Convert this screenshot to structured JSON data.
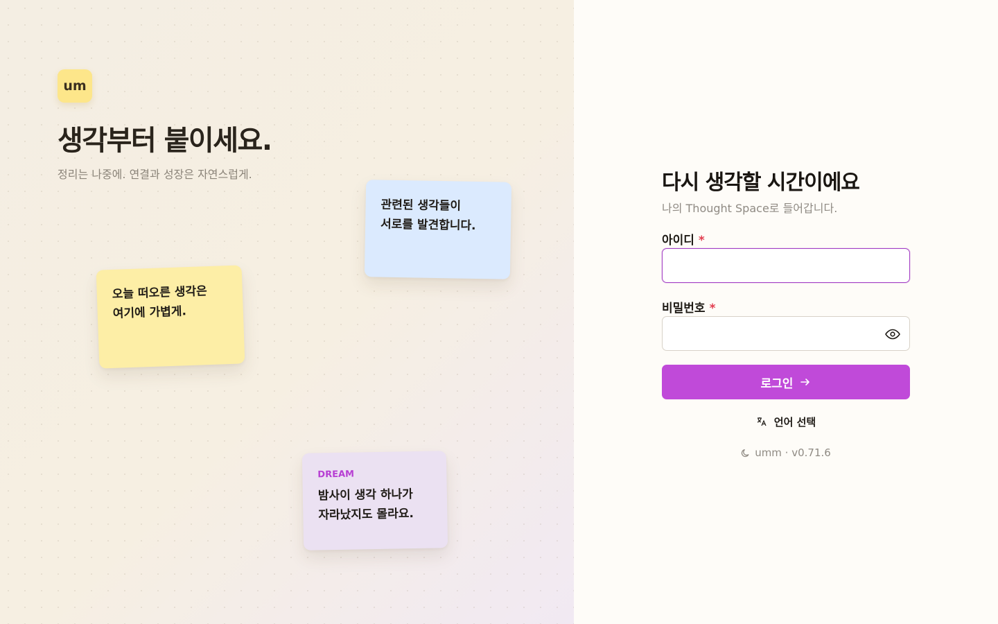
{
  "brand": {
    "logo_text": "um"
  },
  "hero": {
    "headline": "생각부터 붙이세요.",
    "tagline": "정리는 나중에. 연결과 성장은 자연스럽게."
  },
  "notes": {
    "blue": {
      "line1": "관련된 생각들이",
      "line2": "서로를 발견합니다."
    },
    "yellow": {
      "line1": "오늘 떠오른 생각은",
      "line2": "여기에 가볍게."
    },
    "purple": {
      "tag": "DREAM",
      "line1": "밤사이 생각 하나가",
      "line2": "자라났지도 몰라요."
    }
  },
  "login": {
    "title": "다시 생각할 시간이에요",
    "subtitle": "나의 Thought Space로 들어갑니다.",
    "id_label": "아이디",
    "password_label": "비밀번호",
    "required_mark": "*",
    "id_value": "",
    "password_value": "",
    "submit_label": "로그인",
    "language_label": "언어 선택",
    "version": "umm · v0.71.6"
  },
  "colors": {
    "accent": "#c04ad9",
    "note_blue": "#dbeafe",
    "note_yellow": "#fdeea6",
    "note_purple": "#ebe1f2",
    "logo_bg": "#fde68a"
  },
  "icons": {
    "password_toggle": "eye-icon",
    "submit_arrow": "arrow-right-icon",
    "language": "translate-icon",
    "version": "moon-icon"
  }
}
